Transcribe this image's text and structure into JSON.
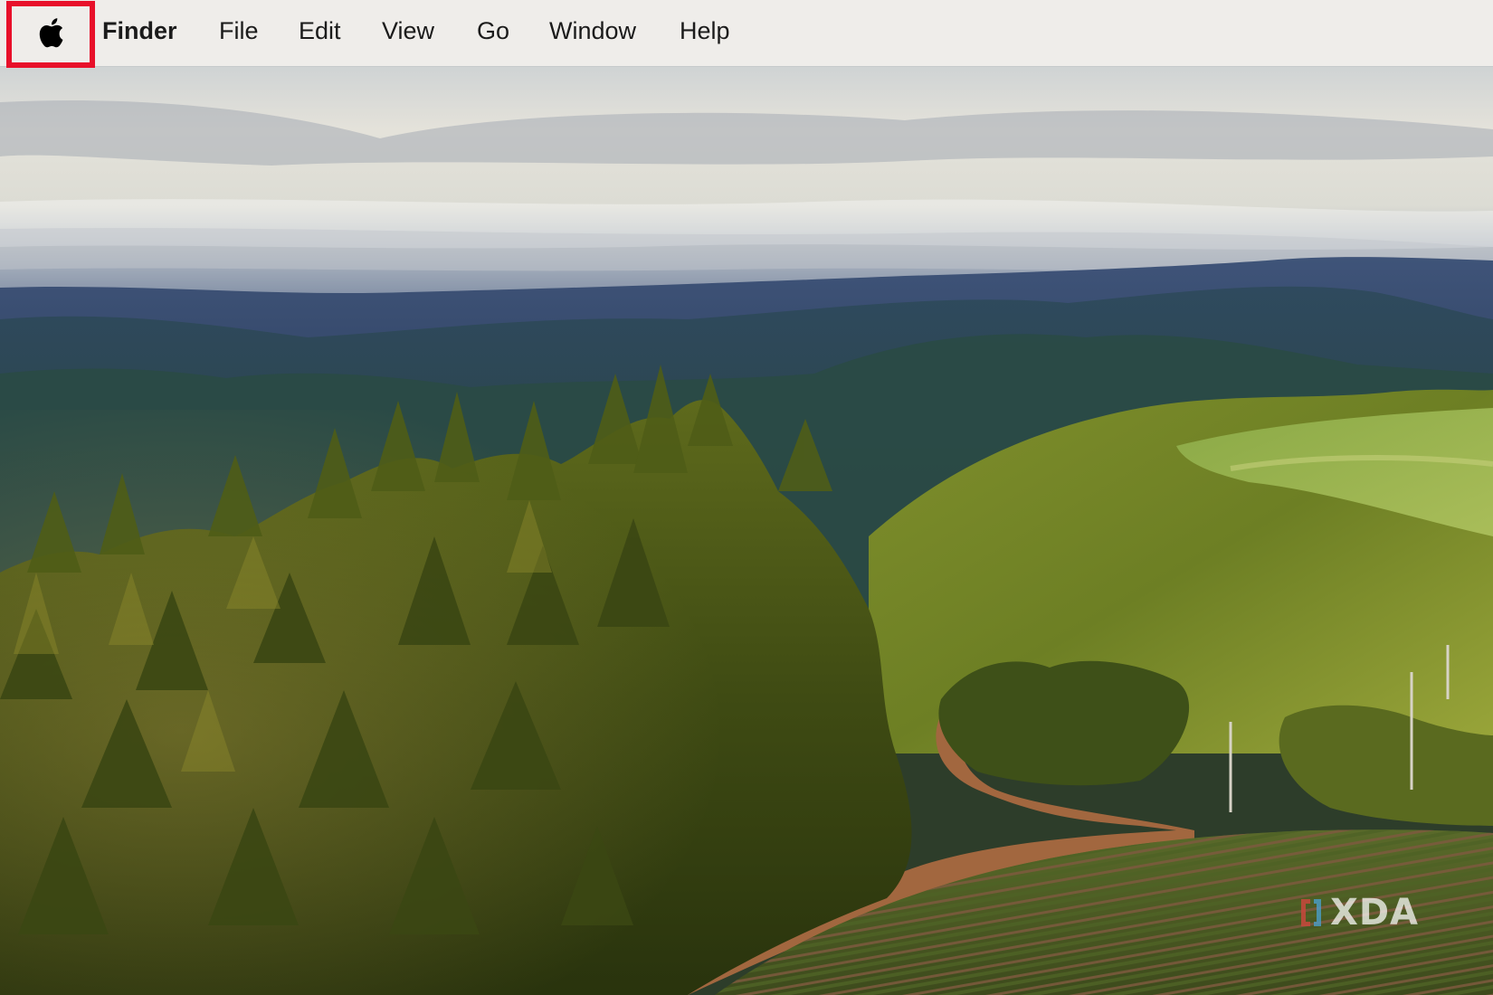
{
  "menubar": {
    "apple_icon": "apple-logo-icon",
    "highlight_color": "#e8102a",
    "app_name": "Finder",
    "items": [
      "File",
      "Edit",
      "View",
      "Go",
      "Window",
      "Help"
    ]
  },
  "wallpaper": {
    "subject": "forested hills with vineyard under cloudy sky"
  },
  "watermark": {
    "text": "XDA",
    "bracket_color": "#c8483c"
  }
}
